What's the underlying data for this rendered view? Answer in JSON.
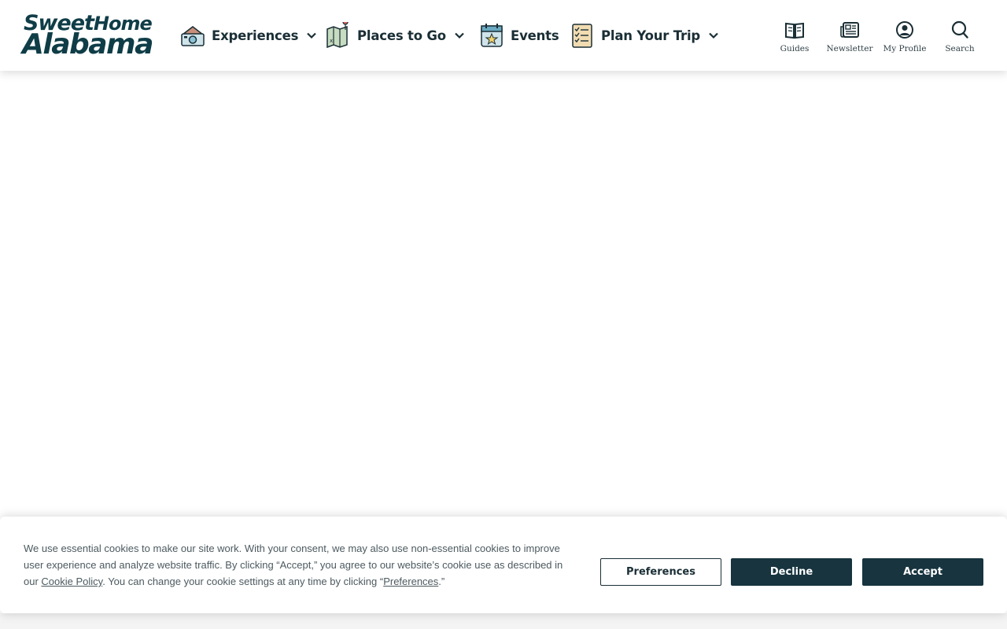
{
  "brand": {
    "line1": "Sweet",
    "line1b": "Home",
    "line2": "Alabama"
  },
  "nav": {
    "experiences": {
      "label": "Experiences",
      "icon": "camera-house-icon"
    },
    "places": {
      "label": "Places to Go",
      "icon": "map-pin-icon"
    },
    "events": {
      "label": "Events",
      "icon": "calendar-star-icon"
    },
    "plan": {
      "label": "Plan Your Trip",
      "icon": "checklist-icon"
    }
  },
  "utility": {
    "guides": {
      "label": "Guides",
      "icon": "open-book-icon"
    },
    "newsletter": {
      "label": "Newsletter",
      "icon": "newspaper-icon"
    },
    "profile": {
      "label": "My Profile",
      "icon": "user-circle-icon"
    },
    "search": {
      "label": "Search",
      "icon": "search-icon"
    }
  },
  "cookie": {
    "text_part1": "We use essential cookies to make our site work. With your consent, we may also use non-essential cookies to improve user experience and analyze website traffic. By clicking “Accept,” you agree to our website’s cookie use as described in our ",
    "cookie_policy_link": "Cookie Policy",
    "text_part2": ". You can change your cookie settings at any time by clicking “",
    "preferences_link": "Preferences",
    "text_part3": ".”",
    "preferences_button": "Preferences",
    "decline_button": "Decline",
    "accept_button": "Accept"
  },
  "colors": {
    "brand_dark": "#0f3d47",
    "button_dark": "#17343f"
  }
}
